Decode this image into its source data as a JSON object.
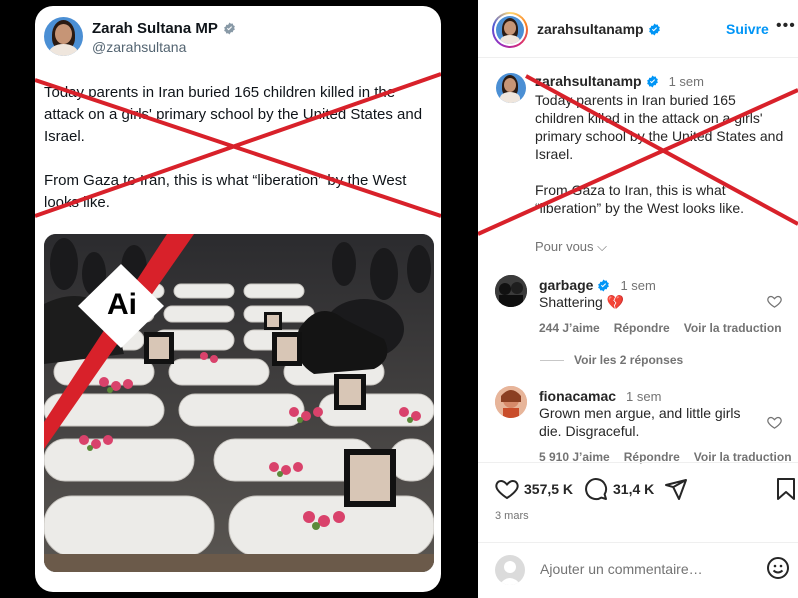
{
  "tweet": {
    "name": "Zarah Sultana MP",
    "handle": "@zarahsultana",
    "text": "Today parents in Iran buried 165 children killed in the attack on a girls' primary school by the United States and Israel.\n\nFrom Gaza to Iran, this is what “liberation” by the West looks like.",
    "ai_label": "Ai"
  },
  "post": {
    "username": "zarahsultanamp",
    "follow_label": "Suivre",
    "more_label": "•••",
    "caption_time": "1 sem",
    "caption_text": "Today parents in Iran buried 165 children killed in the attack on a girls' primary school by the United States and Israel.\n\nFrom Gaza to Iran, this is what “liberation” by the West looks like.",
    "see_translation": "Pour vous ⌵"
  },
  "comments": [
    {
      "user": "garbage",
      "time": "1 sem",
      "text": "Shattering 💔",
      "likes": "244 J’aime",
      "reply_label": "Répondre",
      "translate_label": "Voir la traduction"
    },
    {
      "user": "fionacamac",
      "time": "1 sem",
      "text": "Grown men argue, and little girls die. Disgraceful.",
      "likes": "5 910 J’aime",
      "reply_label": "Répondre",
      "translate_label": "Voir la traduction"
    }
  ],
  "replies_label": "Voir les 2 réponses",
  "actions": {
    "likes": "357,5 K",
    "comments": "31,4 K"
  },
  "date": "3 mars",
  "composer": {
    "placeholder": "Ajouter un commentaire…"
  },
  "colors": {
    "cross_red": "#d8212a",
    "verified_blue": "#1d9bf0",
    "link_blue": "#0095f6"
  }
}
